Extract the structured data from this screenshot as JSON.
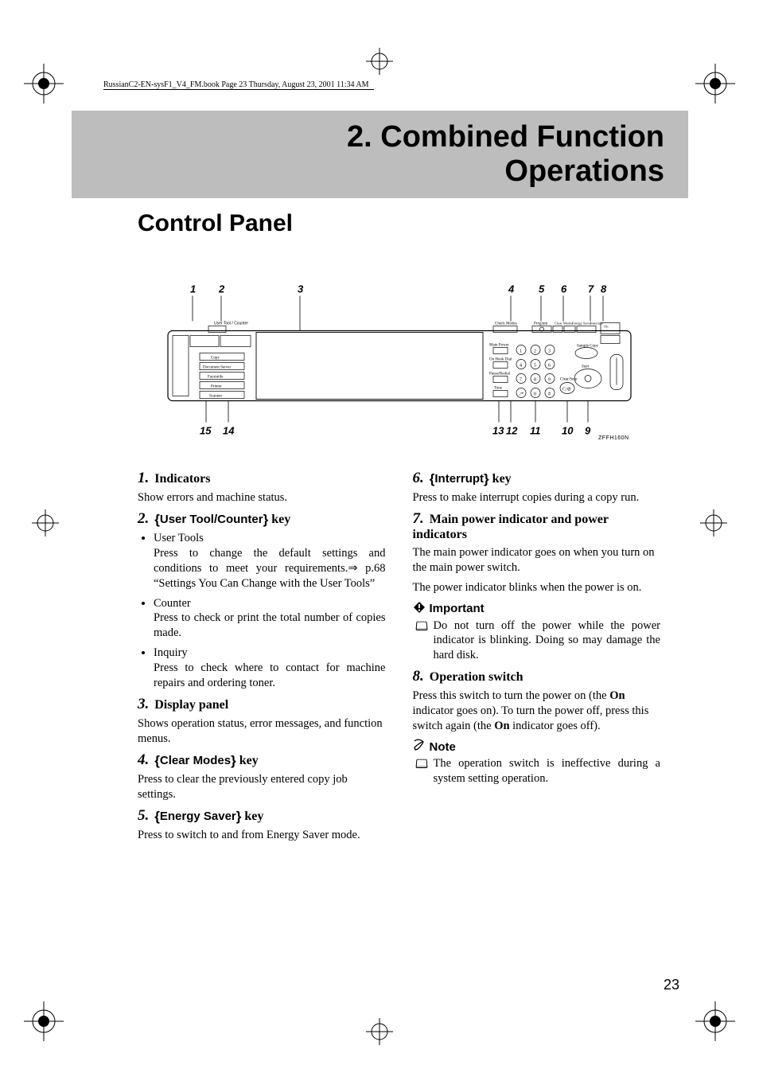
{
  "running_head": "RussianC2-EN-sysF1_V4_FM.book  Page 23  Thursday, August 23, 2001  11:34 AM",
  "chapter_title_line1": "2. Combined Function",
  "chapter_title_line2": "Operations",
  "section_title": "Control Panel",
  "diagram": {
    "callouts_top": [
      "1",
      "2",
      "3",
      "4",
      "5",
      "6",
      "7",
      "8"
    ],
    "callouts_bottom": [
      "15",
      "14",
      "13",
      "12",
      "11",
      "10",
      "9"
    ],
    "fig_code": "ZFFH160N"
  },
  "left": {
    "i1": {
      "num": "1.",
      "title": "Indicators",
      "desc": "Show errors and machine status."
    },
    "i2": {
      "num": "2.",
      "key": "User Tool/Counter",
      "suffix": " key",
      "bullets": [
        {
          "lead": "User Tools",
          "rest": "Press to change the default settings and conditions to meet your requirements.⇒ p.68 “Settings You Can Change with the User Tools”"
        },
        {
          "lead": "Counter",
          "rest": "Press to check or print the total number of copies made."
        },
        {
          "lead": "Inquiry",
          "rest": "Press to check where to contact for machine repairs and ordering toner."
        }
      ]
    },
    "i3": {
      "num": "3.",
      "title": "Display panel",
      "desc": "Shows operation status, error messages, and function menus."
    },
    "i4": {
      "num": "4.",
      "key": "Clear Modes",
      "suffix": " key",
      "desc": "Press to clear the previously entered copy job settings."
    },
    "i5": {
      "num": "5.",
      "key": "Energy Saver",
      "suffix": " key",
      "desc": "Press to switch to and from Energy Saver mode."
    }
  },
  "right": {
    "i6": {
      "num": "6.",
      "key": "Interrupt",
      "suffix": " key",
      "desc": "Press to make interrupt copies during a copy run."
    },
    "i7": {
      "num": "7.",
      "title": "Main power indicator and power indicators",
      "desc1": "The main power indicator goes on when you turn on the main power switch.",
      "desc2": "The power indicator blinks when the power is on.",
      "important_label": "Important",
      "important_item": "Do not turn off the power while the power indicator is blinking. Doing so may damage the hard disk."
    },
    "i8": {
      "num": "8.",
      "title": "Operation switch",
      "desc_pre": "Press this switch to turn the power on (the ",
      "on1": "On",
      "desc_mid": " indicator goes on). To turn the power off, press this switch again (the ",
      "on2": "On",
      "desc_post": " indicator goes off).",
      "note_label": "Note",
      "note_item": "The operation switch is ineffective during a system setting operation."
    }
  },
  "page_number": "23"
}
